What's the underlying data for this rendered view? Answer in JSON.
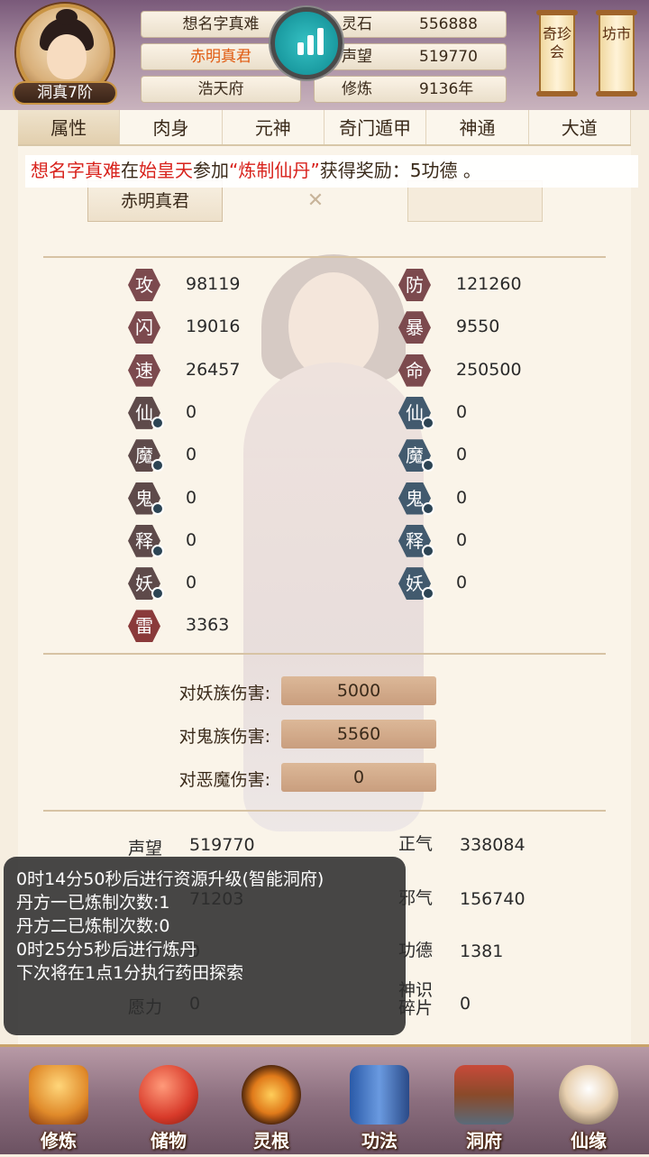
{
  "player": {
    "name": "想名字真难",
    "title": "赤明真君",
    "hall": "浩天府",
    "rank": "洞真7阶"
  },
  "resources": [
    {
      "label": "灵石",
      "value": "556888"
    },
    {
      "label": "声望",
      "value": "519770"
    },
    {
      "label": "修炼",
      "value": "9136年"
    }
  ],
  "shortcuts": {
    "market": "奇珍会",
    "shop": "坊市"
  },
  "tabs": [
    "属性",
    "肉身",
    "元神",
    "奇门遁甲",
    "神通",
    "大道"
  ],
  "notice": {
    "player": "想名字真难",
    "mid1": "在",
    "place": "始皇天",
    "mid2": "参加",
    "event": "“炼制仙丹”",
    "reward": "获得奖励：5功德 。"
  },
  "rank_box": "赤明真君",
  "left_stats": [
    {
      "icon": "攻",
      "value": "98119"
    },
    {
      "icon": "闪",
      "value": "19016"
    },
    {
      "icon": "速",
      "value": "26457"
    },
    {
      "icon": "仙",
      "value": "0"
    },
    {
      "icon": "魔",
      "value": "0"
    },
    {
      "icon": "鬼",
      "value": "0"
    },
    {
      "icon": "释",
      "value": "0"
    },
    {
      "icon": "妖",
      "value": "0"
    },
    {
      "icon": "雷",
      "value": "3363"
    }
  ],
  "right_stats": [
    {
      "icon": "防",
      "value": "121260"
    },
    {
      "icon": "暴",
      "value": "9550"
    },
    {
      "icon": "命",
      "value": "250500"
    },
    {
      "icon": "仙",
      "value": "0"
    },
    {
      "icon": "魔",
      "value": "0"
    },
    {
      "icon": "鬼",
      "value": "0"
    },
    {
      "icon": "释",
      "value": "0"
    },
    {
      "icon": "妖",
      "value": "0"
    }
  ],
  "damage": [
    {
      "label": "对妖族伤害:",
      "value": "5000"
    },
    {
      "label": "对鬼族伤害:",
      "value": "5560"
    },
    {
      "label": "对恶魔伤害:",
      "value": "0"
    }
  ],
  "bottom_stats_left": [
    {
      "label": "声望",
      "value": "519770"
    },
    {
      "label": "",
      "value": "71203"
    },
    {
      "label": "",
      "value": "0"
    },
    {
      "label": "愿力",
      "value": "0"
    }
  ],
  "bottom_stats_right": [
    {
      "label": "正气",
      "value": "338084"
    },
    {
      "label": "邪气",
      "value": "156740"
    },
    {
      "label": "功德",
      "value": "1381"
    },
    {
      "label": "神识碎片",
      "value": "0"
    }
  ],
  "log": [
    "0时14分50秒后进行资源升级(智能洞府)",
    "丹方一已炼制次数:1",
    "丹方二已炼制次数:0",
    "0时25分5秒后进行炼丹",
    "下次将在1点1分执行药田探索"
  ],
  "nav": [
    "修炼",
    "储物",
    "灵根",
    "功法",
    "洞府",
    "仙缘"
  ]
}
